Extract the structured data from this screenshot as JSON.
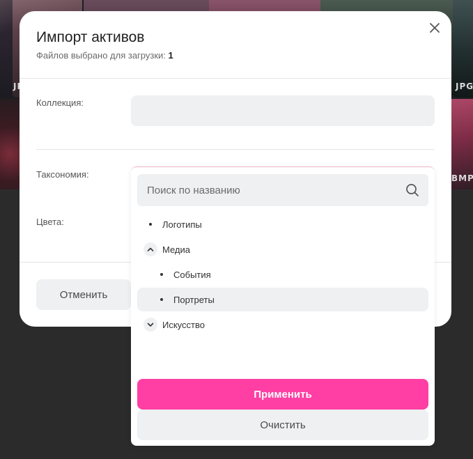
{
  "background": {
    "tile_labels": [
      "JPG",
      "JPG",
      "BMP"
    ]
  },
  "modal": {
    "title": "Импорт активов",
    "subtitle_prefix": "Файлов выбрано для загрузки:",
    "subtitle_count": "1",
    "fields": {
      "collection_label": "Коллекция:",
      "taxonomy_label": "Таксономия:",
      "colors_label": "Цвета:"
    },
    "cancel_label": "Отменить"
  },
  "dropdown": {
    "search_placeholder": "Поиск по названию",
    "items": [
      {
        "label": "Логотипы",
        "level": 0,
        "type": "leaf",
        "selected": false
      },
      {
        "label": "Медиа",
        "level": 0,
        "type": "expanded",
        "selected": false
      },
      {
        "label": "События",
        "level": 1,
        "type": "leaf",
        "selected": false
      },
      {
        "label": "Портреты",
        "level": 1,
        "type": "leaf",
        "selected": true
      },
      {
        "label": "Искусство",
        "level": 0,
        "type": "collapsed",
        "selected": false
      }
    ],
    "apply_label": "Применить",
    "clear_label": "Очистить"
  },
  "colors": {
    "accent": "#ff3fa4",
    "field_bg": "#eef0f2",
    "overlay": "#2b2b2b"
  }
}
